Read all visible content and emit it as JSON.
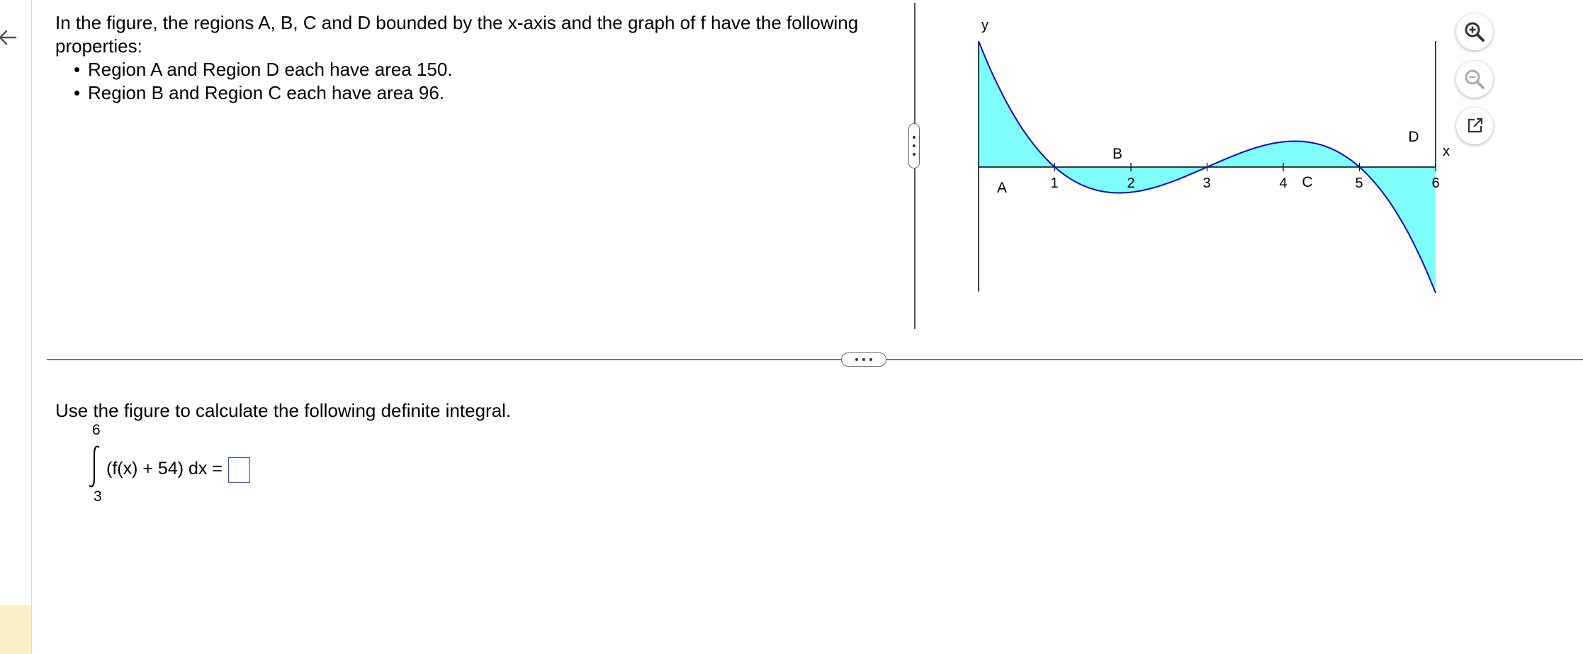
{
  "question": {
    "intro": "In the figure, the regions A, B, C and D bounded by the x-axis and the graph of f have the following properties:",
    "bullets": [
      "Region A and Region D each have area 150.",
      "Region B and Region C each have area 96."
    ],
    "bullet_symbol": "•"
  },
  "graph": {
    "y_label": "y",
    "x_label": "x",
    "x_ticks": [
      "1",
      "2",
      "3",
      "4",
      "5",
      "6"
    ],
    "region_labels": [
      "A",
      "B",
      "C",
      "D"
    ],
    "fill_color": "#7ffcfc",
    "curve_color": "#0a0ad0"
  },
  "toolbar": {
    "zoom_in_icon": "zoom-in-icon",
    "zoom_out_icon": "zoom-out-icon",
    "open_external_icon": "open-external-icon"
  },
  "task": {
    "instruction": "Use the figure to calculate the following definite integral.",
    "upper_limit": "6",
    "lower_limit": "3",
    "integrand": "(f(x) + 54) dx =",
    "answer_value": ""
  },
  "colors": {
    "accent_blue": "#2b4fd6",
    "side_tab": "#fcf0c8"
  }
}
